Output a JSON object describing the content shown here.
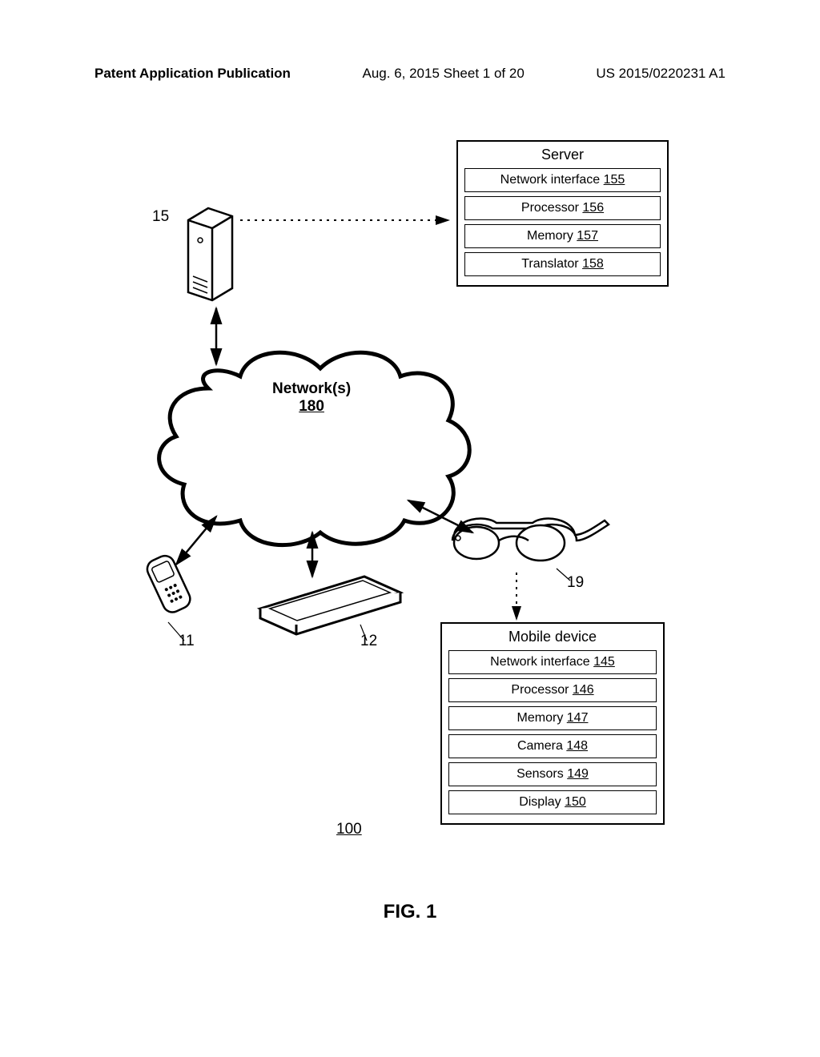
{
  "header": {
    "left": "Patent Application Publication",
    "center": "Aug. 6, 2015  Sheet 1 of 20",
    "right": "US 2015/0220231 A1"
  },
  "figure_caption": "FIG. 1",
  "labels": {
    "server_ref": "15",
    "phone_ref": "11",
    "tablet_ref": "12",
    "glasses_ref": "19",
    "system_ref": "100"
  },
  "cloud": {
    "name": "Network(s)",
    "ref": "180"
  },
  "server_box": {
    "title": "Server",
    "rows": [
      {
        "label": "Network interface",
        "ref": "155"
      },
      {
        "label": "Processor",
        "ref": "156"
      },
      {
        "label": "Memory",
        "ref": "157"
      },
      {
        "label": "Translator",
        "ref": "158"
      }
    ]
  },
  "mobile_box": {
    "title": "Mobile device",
    "rows": [
      {
        "label": "Network interface",
        "ref": "145"
      },
      {
        "label": "Processor",
        "ref": "146"
      },
      {
        "label": "Memory",
        "ref": "147"
      },
      {
        "label": "Camera",
        "ref": "148"
      },
      {
        "label": "Sensors",
        "ref": "149"
      },
      {
        "label": "Display",
        "ref": "150"
      }
    ]
  }
}
